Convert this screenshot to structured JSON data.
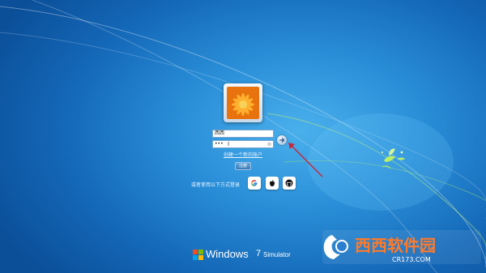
{
  "login": {
    "username_value": "西西",
    "password_value": "•••",
    "create_account_link": "创建一个新的账户",
    "register_button": "注册",
    "alt_login_label": "或者使用以下方式登录"
  },
  "social": [
    "google-icon",
    "apple-icon",
    "github-icon"
  ],
  "branding": {
    "windows_text": "Windows",
    "version_text": "7",
    "simulator_text": "Simulator"
  },
  "watermark": {
    "main_text": "西西软件园",
    "url_text": "CR173.COM"
  },
  "colors": {
    "background": "#1a7bd0",
    "annotation": "#c8263a",
    "flag_red": "#f25022",
    "flag_green": "#7fba00",
    "flag_blue": "#00a4ef",
    "flag_yellow": "#ffb900"
  }
}
